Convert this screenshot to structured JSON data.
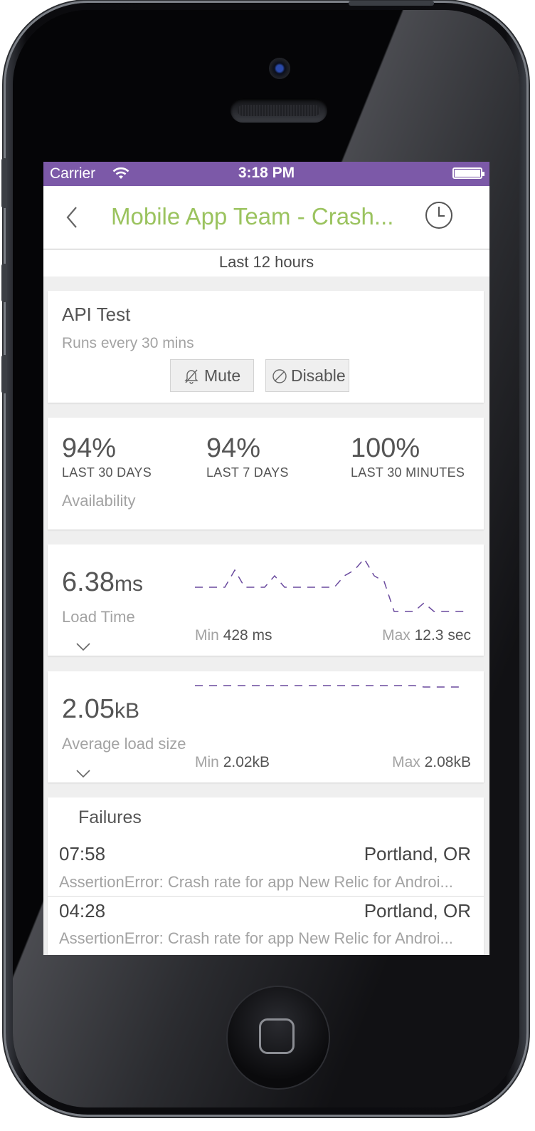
{
  "status_bar": {
    "carrier": "Carrier",
    "time": "3:18 PM"
  },
  "nav": {
    "title": "Mobile App Team - Crash..."
  },
  "range": {
    "label": "Last 12 hours"
  },
  "monitor": {
    "name": "API Test",
    "schedule": "Runs every 30 mins",
    "mute_label": "Mute",
    "disable_label": "Disable"
  },
  "availability": {
    "stats": [
      {
        "value": "94%",
        "label": "LAST 30 DAYS"
      },
      {
        "value": "94%",
        "label": "LAST 7 DAYS"
      },
      {
        "value": "100%",
        "label": "LAST 30 MINUTES"
      }
    ],
    "label": "Availability"
  },
  "load_time": {
    "value": "6.38",
    "unit": "ms",
    "label": "Load Time",
    "min_label": "Min",
    "min_value": "428 ms",
    "max_label": "Max",
    "max_value": "12.3 sec"
  },
  "load_size": {
    "value": "2.05",
    "unit": "kB",
    "label": "Average load size",
    "min_label": "Min",
    "min_value": "2.02kB",
    "max_label": "Max",
    "max_value": "2.08kB"
  },
  "failures": {
    "title": "Failures",
    "items": [
      {
        "time": "07:58",
        "location": "Portland, OR",
        "message": "AssertionError: Crash rate for app New Relic for Androi..."
      },
      {
        "time": "04:28",
        "location": "Portland, OR",
        "message": "AssertionError: Crash rate for app New Relic for Androi..."
      }
    ]
  },
  "colors": {
    "status_bar": "#7c59a8",
    "title": "#9bc35f",
    "sparkline": "#6a4a9e"
  },
  "icons": [
    "wifi-icon",
    "battery-icon",
    "back-chevron-icon",
    "clock-icon",
    "bell-muted-icon",
    "disable-icon",
    "expand-chevron-icon"
  ]
}
